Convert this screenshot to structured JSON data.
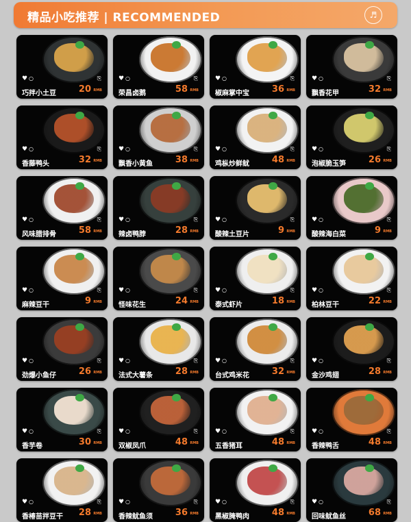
{
  "header": {
    "title": "精品小吃推荐 |  RECOMMENDED",
    "logo_icon": "brand-logo"
  },
  "currency": "RMB",
  "colors": {
    "accent": "#f47a2c",
    "card_bg": "#050505",
    "page_bg": "#c9c9c9"
  },
  "items": [
    {
      "name": "巧拌小土豆",
      "price": "20",
      "plate": "#2f3334",
      "food": "#d9a44a"
    },
    {
      "name": "荣昌卤鹅",
      "price": "58",
      "plate": "#f2f2f2",
      "food": "#c9742a"
    },
    {
      "name": "椒麻掌中宝",
      "price": "36",
      "plate": "#f4f4f4",
      "food": "#e0a04a"
    },
    {
      "name": "飘香花甲",
      "price": "32",
      "plate": "#3a3a3a",
      "food": "#d8c2a0"
    },
    {
      "name": "香藤鸭头",
      "price": "32",
      "plate": "#1a1a1a",
      "food": "#b5522a"
    },
    {
      "name": "飘香小黄鱼",
      "price": "38",
      "plate": "#cfcfcf",
      "food": "#b66a3a"
    },
    {
      "name": "鸡枞炒鲜鱿",
      "price": "48",
      "plate": "#f2f2f2",
      "food": "#d9b07a"
    },
    {
      "name": "泡椒脆玉笋",
      "price": "26",
      "plate": "#1f1f1f",
      "food": "#d9d070"
    },
    {
      "name": "风味腊排骨",
      "price": "58",
      "plate": "#f0f0f0",
      "food": "#a04b2f"
    },
    {
      "name": "辣卤鸭脖",
      "price": "28",
      "plate": "#36403d",
      "food": "#8a3b25"
    },
    {
      "name": "酸辣土豆片",
      "price": "9",
      "plate": "#2a2a2a",
      "food": "#e8c070"
    },
    {
      "name": "酸辣海白菜",
      "price": "9",
      "plate": "#e9c9c9",
      "food": "#4b6b2a"
    },
    {
      "name": "麻辣豆干",
      "price": "9",
      "plate": "#f0f0f0",
      "food": "#c9874a"
    },
    {
      "name": "怪味花生",
      "price": "24",
      "plate": "#4a4a4a",
      "food": "#c58a4a"
    },
    {
      "name": "泰式虾片",
      "price": "18",
      "plate": "#efefef",
      "food": "#f0e0c0"
    },
    {
      "name": "柏林豆干",
      "price": "22",
      "plate": "#f2f2f2",
      "food": "#e8c89a"
    },
    {
      "name": "劲爆小鱼仔",
      "price": "26",
      "plate": "#3b3b3b",
      "food": "#9a3f22"
    },
    {
      "name": "法式大薯条",
      "price": "28",
      "plate": "#e8e8e8",
      "food": "#e9b24a"
    },
    {
      "name": "台式鸡米花",
      "price": "32",
      "plate": "#ececec",
      "food": "#d08a3a"
    },
    {
      "name": "金沙鸡翅",
      "price": "28",
      "plate": "#1c1c1c",
      "food": "#e0a050"
    },
    {
      "name": "香芋卷",
      "price": "30",
      "plate": "#3a4a48",
      "food": "#f2e2d2"
    },
    {
      "name": "双椒凤爪",
      "price": "48",
      "plate": "#202020",
      "food": "#c2643a"
    },
    {
      "name": "五香猪耳",
      "price": "48",
      "plate": "#f2f2f2",
      "food": "#e0b090"
    },
    {
      "name": "香辣鸭舌",
      "price": "48",
      "plate": "#e07a3a",
      "food": "#9a6a3a"
    },
    {
      "name": "香椿苗拌豆干",
      "price": "28",
      "plate": "#f2f2f2",
      "food": "#d8b48a"
    },
    {
      "name": "香辣鱿鱼须",
      "price": "36",
      "plate": "#3a3a3a",
      "food": "#c26a3a"
    },
    {
      "name": "黑椒腌鸭肉",
      "price": "48",
      "plate": "#f0f0f0",
      "food": "#c24a4a"
    },
    {
      "name": "回味鱿鱼丝",
      "price": "68",
      "plate": "#2a3a3e",
      "food": "#d8a8a0"
    }
  ]
}
